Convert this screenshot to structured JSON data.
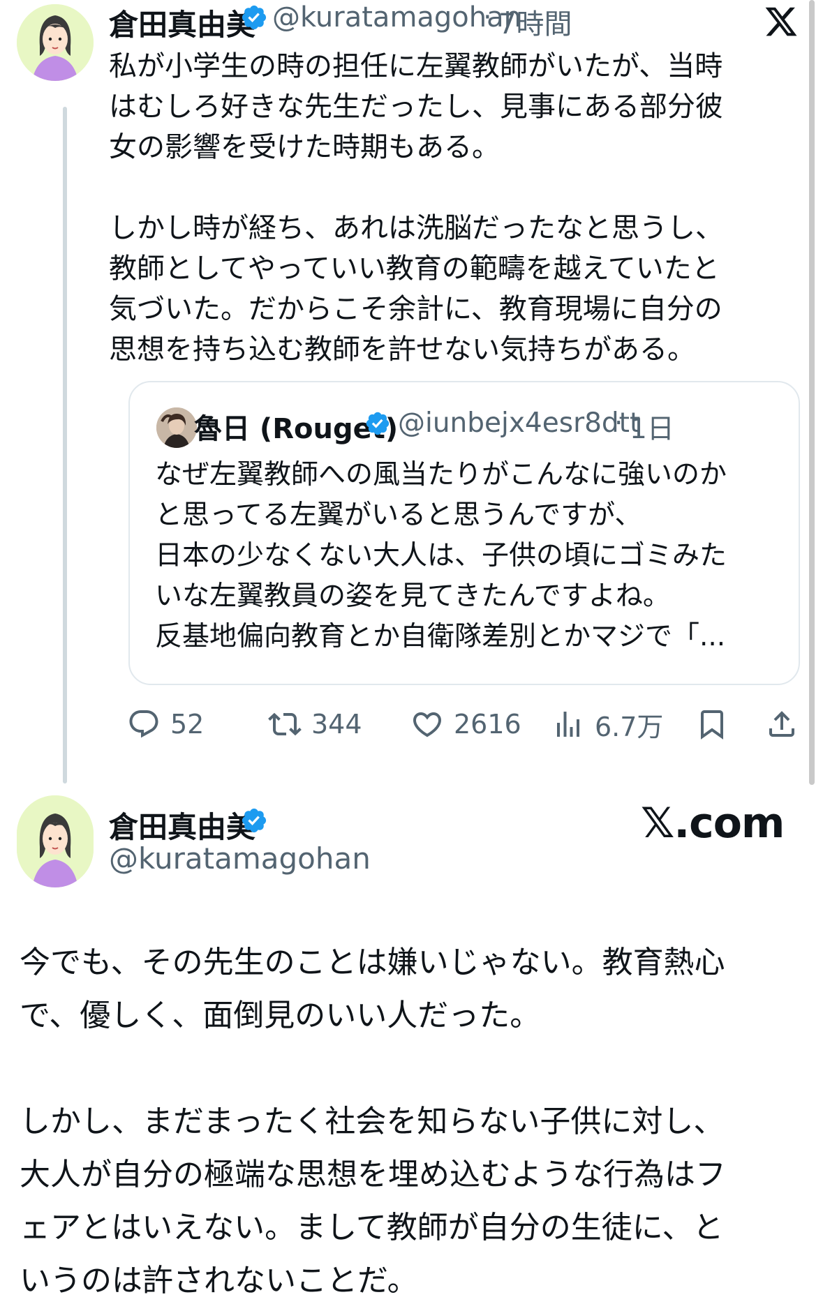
{
  "tweet": {
    "author_name": "倉田真由美",
    "handle": "@kuratamagohan",
    "time": "7時間",
    "platform_icon": "x-logo-icon",
    "text": "私が小学生の時の担任に左翼教師がいたが、当時\nはむしろ好きな先生だったし、見事にある部分彼\n女の影響を受けた時期もある。\n\nしかし時が経ち、あれは洗脳だったなと思うし、\n教師としてやっていい教育の範疇を越えていたと\n気づいた。だからこそ余計に、教育現場に自分の\n思想を持ち込む教師を許せない気持ちがある。"
  },
  "quote": {
    "author_name": "魯日 (Rouget)",
    "handle": "@iunbejx4esr8dtt",
    "time": "1日",
    "text": "なぜ左翼教師への風当たりがこんなに強いのか\nと思ってる左翼がいると思うんですが、\n日本の少なくない大人は、子供の頃にゴミみた\nいな左翼教員の姿を見てきたんですよね。\n反基地偏向教育とか自衛隊差別とかマジで「..."
  },
  "actions": {
    "replies": "52",
    "retweets": "344",
    "likes": "2616",
    "views": "6.7万"
  },
  "profile": {
    "author_name": "倉田真由美",
    "handle": "@kuratamagohan",
    "site": "𝕏.com"
  },
  "reply_text": "今でも、その先生のことは嫌いじゃない。教育熱心\nで、優しく、面倒見のいい人だった。\n\nしかし、まだまったく社会を知らない子供に対し、\n大人が自分の極端な思想を埋め込むような行為はフ\nェアとはいえない。まして教師が自分の生徒に、と\nいうのは許されないことだ。",
  "colors": {
    "verified": "#1d9bf0",
    "avatar_bg": "#e8f7c4",
    "shirt": "#c08ee6",
    "secondary_text": "#536471"
  }
}
